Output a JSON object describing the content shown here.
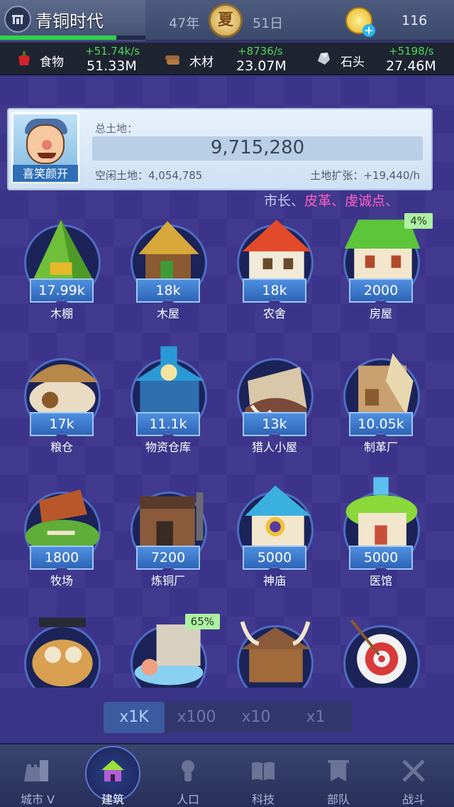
{
  "header": {
    "city_name": "青铜时代",
    "city_progress": 0.8,
    "year": "47年",
    "season": "夏",
    "day": "51日",
    "gems": "116"
  },
  "resources": [
    {
      "name": "食物",
      "rate": "+51.74k/s",
      "total": "51.33M",
      "icon": "food-icon"
    },
    {
      "name": "木材",
      "rate": "+8736/s",
      "total": "23.07M",
      "icon": "wood-icon"
    },
    {
      "name": "石头",
      "rate": "+5198/s",
      "total": "27.46M",
      "icon": "stone-icon"
    }
  ],
  "land": {
    "avatar_label": "喜笑颜开",
    "title": "总土地：",
    "total": "9,715,280",
    "free_label": "空闲土地：4,054,785",
    "expand_label": "土地扩张：+19,440/h"
  },
  "ticker": {
    "part1": "市长、",
    "part2": "皮革、",
    "part3": "虔诚点、"
  },
  "buildings": [
    {
      "name": "木棚",
      "count": "17.99k",
      "art": "hut"
    },
    {
      "name": "木屋",
      "count": "18k",
      "art": "cabin"
    },
    {
      "name": "农舍",
      "count": "18k",
      "art": "farmhouse"
    },
    {
      "name": "房屋",
      "count": "2000",
      "art": "house",
      "progress": "4%"
    },
    {
      "name": "粮仓",
      "count": "17k",
      "art": "granary"
    },
    {
      "name": "物资仓库",
      "count": "11.1k",
      "art": "warehouse"
    },
    {
      "name": "猎人小屋",
      "count": "13k",
      "art": "hunter"
    },
    {
      "name": "制革厂",
      "count": "10.05k",
      "art": "tannery"
    },
    {
      "name": "牧场",
      "count": "1800",
      "art": "ranch"
    },
    {
      "name": "炼铜厂",
      "count": "7200",
      "art": "smelter"
    },
    {
      "name": "神庙",
      "count": "5000",
      "art": "temple"
    },
    {
      "name": "医馆",
      "count": "5000",
      "art": "clinic"
    },
    {
      "name": "",
      "count": "",
      "art": "school"
    },
    {
      "name": "",
      "count": "",
      "art": "bathhouse",
      "progress": "65%"
    },
    {
      "name": "",
      "count": "",
      "art": "barracks"
    },
    {
      "name": "",
      "count": "",
      "art": "range"
    }
  ],
  "multipliers": [
    "x1K",
    "x100",
    "x10",
    "x1"
  ],
  "active_multiplier": "x1K",
  "nav": [
    {
      "label": "城市 V",
      "icon": "castle-icon"
    },
    {
      "label": "建筑",
      "icon": "build-house-icon"
    },
    {
      "label": "人口",
      "icon": "population-icon"
    },
    {
      "label": "科技",
      "icon": "book-icon"
    },
    {
      "label": "部队",
      "icon": "banner-icon"
    },
    {
      "label": "战斗",
      "icon": "crossed-swords-icon"
    }
  ],
  "colors": {
    "background": "#3b348a",
    "rate_green": "#49d957",
    "badge_blue": "#2e65b8",
    "progress_green": "#2ed14a"
  }
}
